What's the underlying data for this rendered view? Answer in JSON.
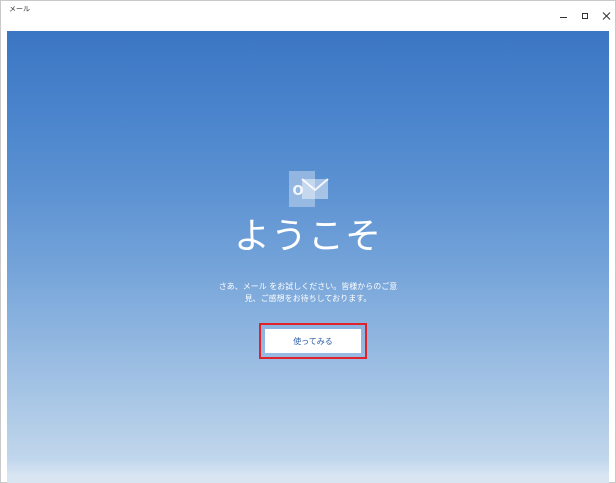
{
  "window": {
    "title": "メール"
  },
  "controls": {
    "minimize_icon": "minimize-icon",
    "maximize_icon": "maximize-icon",
    "close_icon": "close-icon"
  },
  "welcome": {
    "logo_icon": "outlook-mail-icon",
    "logo_letter": "O",
    "heading": "ようこそ",
    "description_line1": "さあ、メール をお試しください。皆様からのご意",
    "description_line2": "見、ご感想をお待ちしております。",
    "button_label": "使ってみる"
  },
  "colors": {
    "highlight_border": "#e0232b",
    "button_text": "#2b5fa6"
  }
}
